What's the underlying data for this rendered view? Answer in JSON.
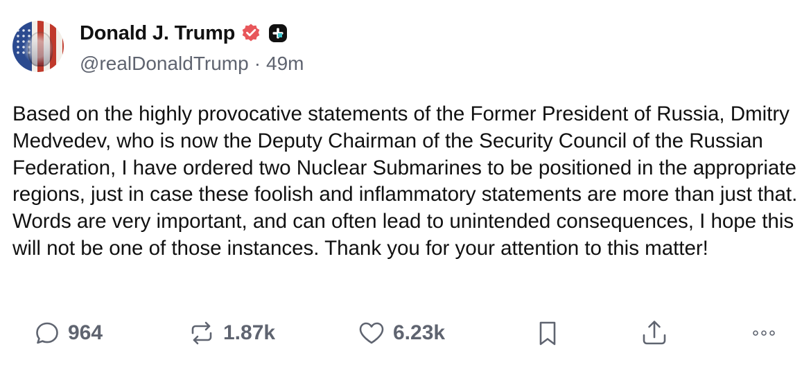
{
  "post": {
    "author": {
      "display_name": "Donald J. Trump",
      "handle": "@realDonaldTrump",
      "verified": true,
      "badge_icon": "plus-badge-icon"
    },
    "timestamp": "49m",
    "separator": "·",
    "text": "Based on the highly provocative statements of the Former President of Russia, Dmitry Medvedev, who is now the Deputy Chairman of the Security Council of the Russian Federation, I have ordered two Nuclear Submarines to be positioned in the appropriate regions, just in case these foolish and inflammatory statements are more than just that. Words are very important, and can often lead to unintended consequences, I hope this will not be one of those instances. Thank you for your attention to this matter!"
  },
  "actions": {
    "replies": {
      "icon": "reply-icon",
      "count": "964"
    },
    "reposts": {
      "icon": "repost-icon",
      "count": "1.87k"
    },
    "likes": {
      "icon": "heart-icon",
      "count": "6.23k"
    },
    "bookmark": {
      "icon": "bookmark-icon"
    },
    "share": {
      "icon": "share-icon"
    },
    "more": {
      "icon": "more-icon"
    }
  },
  "colors": {
    "verified_badge": "#e8575b",
    "muted_text": "#5f6470",
    "body_text": "#111111"
  }
}
